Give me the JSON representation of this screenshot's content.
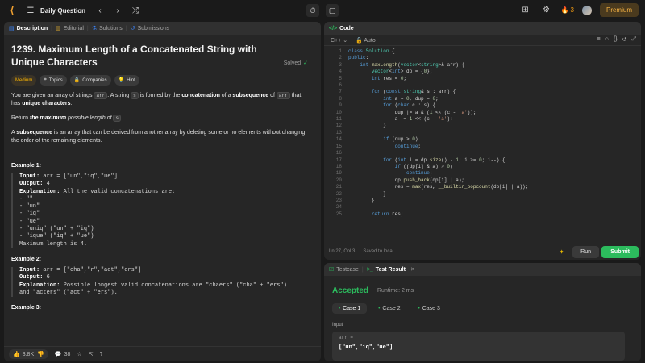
{
  "nav": {
    "title": "Daily Question",
    "streak": "3",
    "premium": "Premium"
  },
  "left": {
    "tabs": [
      "Description",
      "Editorial",
      "Solutions",
      "Submissions"
    ],
    "problem_title": "1239. Maximum Length of a Concatenated String with Unique Characters",
    "solved_label": "Solved",
    "chips": [
      "Medium",
      "Topics",
      "Companies",
      "Hint"
    ],
    "para1": {
      "a": "You are given an array of strings ",
      "code1": "arr",
      "b": ". A string ",
      "code2": "s",
      "c": " is formed by the ",
      "b1": "concatenation",
      "d": " of a ",
      "b2": "subsequence",
      "e": " of ",
      "code3": "arr",
      "f": " that has ",
      "b3": "unique characters",
      "g": "."
    },
    "para2": {
      "a": "Return ",
      "b1": "the maximum",
      "b": " possible length",
      "c": " of ",
      "code1": "s",
      "d": "."
    },
    "para3": {
      "b1": "subsequence",
      "pre": "A ",
      "rest": " is an array that can be derived from another array by deleting some or no elements without changing the order of the remaining elements."
    },
    "example1": {
      "title": "Example 1:",
      "input_label": "Input:",
      "input": " arr = [\"un\",\"iq\",\"ue\"]",
      "output_label": "Output:",
      "output": " 4",
      "explanation_label": "Explanation:",
      "explanation": " All the valid concatenations are:",
      "lines": [
        "- \"\"",
        "- \"un\"",
        "- \"iq\"",
        "- \"ue\"",
        "- \"uniq\" (\"un\" + \"iq\")",
        "- \"ique\" (\"iq\" + \"ue\")",
        "Maximum length is 4."
      ]
    },
    "example2": {
      "title": "Example 2:",
      "input_label": "Input:",
      "input": " arr = [\"cha\",\"r\",\"act\",\"ers\"]",
      "output_label": "Output:",
      "output": " 6",
      "explanation_label": "Explanation:",
      "explanation": " Possible longest valid concatenations are \"chaers\" (\"cha\" + \"ers\")",
      "explanation2": "and \"acters\" (\"act\" + \"ers\")."
    },
    "example3_title": "Example 3:",
    "footer": {
      "likes": "3.8K",
      "comments": "38"
    }
  },
  "code": {
    "tab": "Code",
    "language": "C++",
    "auto": "Auto",
    "cursor": "Ln 27, Col 3",
    "saved": "Saved to local",
    "run": "Run",
    "submit": "Submit",
    "line_numbers": [
      "1",
      "2",
      "3",
      "4",
      "5",
      "6",
      "7",
      "8",
      "9",
      "10",
      "11",
      "12",
      "13",
      "14",
      "15",
      "16",
      "17",
      "18",
      "19",
      "20",
      "21",
      "22",
      "23",
      "24",
      "25"
    ]
  },
  "result": {
    "tabs": [
      "Testcase",
      "Test Result"
    ],
    "status": "Accepted",
    "runtime": "Runtime: 2 ms",
    "cases": [
      "Case 1",
      "Case 2",
      "Case 3"
    ],
    "input_label": "Input",
    "var_name": "arr =",
    "var_value": "[\"un\",\"iq\",\"ue\"]"
  }
}
